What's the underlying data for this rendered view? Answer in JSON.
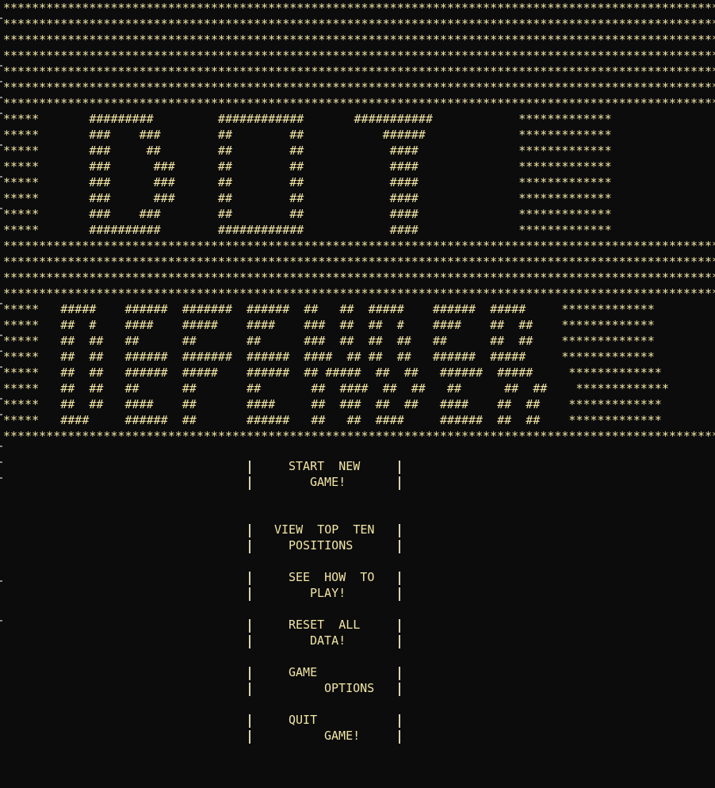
{
  "title_art": {
    "border_line": "**********************************************************************************************************************",
    "dot_rows": [
      "*****       #########         ############       ###########            *************",
      "*****       ###    ###        ##        ##           ######             *************",
      "*****       ###     ##        ##        ##            ####              *************",
      "*****       ###      ###      ##        ##            ####              *************",
      "*****       ###      ###      ##        ##            ####              *************",
      "*****       ###      ###      ##        ##            ####              *************",
      "*****       ###    ###        ##        ##            ####              *************",
      "*****       ##########        ############            ####              *************"
    ],
    "defender_rows": [
      "*****   #####    ######  #######  ######  ##   ##  #####    ######  #####     *************",
      "*****   ##  #    ####    #####    ####    ###  ##  ##  #    ####    ##  ##    *************",
      "*****   ##  ##   ##      ##       ##      ###  ##  ##  ##   ##      ##  ##    *************",
      "*****   ##  ##   ######  #######  ######  ####  ## ##  ##   ######  #####     *************",
      "*****   ##  ##   ######  #####    ######  ## #####  ##  ##   ######  #####     *************",
      "*****   ##  ##   ##      ##       ##       ##  ####  ##  ##   ##      ##  ##    *************",
      "*****   ##  ##   ####    ##       ####     ##  ###  ##  ##   ####    ##  ##    *************",
      "*****   ####     ######  ##       ######   ##   ##  ####     ######  ##  ##    *************"
    ]
  },
  "menu": {
    "items": [
      {
        "line1": "START  NEW",
        "line2": "GAME!"
      },
      {
        "line1": "VIEW  TOP  TEN",
        "line2": "POSITIONS"
      },
      {
        "line1": "SEE  HOW  TO",
        "line2": "PLAY!"
      },
      {
        "line1": "RESET  ALL",
        "line2": "DATA!"
      },
      {
        "line1": "GAME",
        "line2": "OPTIONS"
      },
      {
        "line1": "QUIT",
        "line2": "GAME!"
      }
    ]
  },
  "colors": {
    "background": "#0c0c0c",
    "text": "#f2e6a6"
  }
}
